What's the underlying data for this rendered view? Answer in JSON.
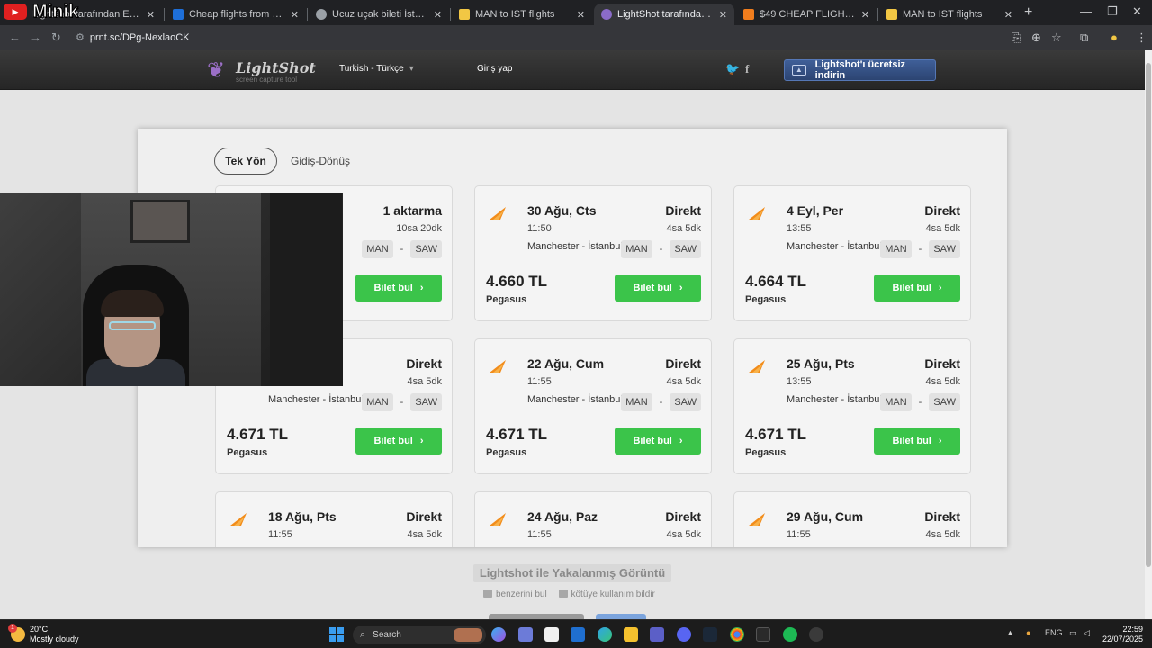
{
  "browser": {
    "tabs": [
      {
        "title": "Lightshot tarafından Ekran Görü",
        "favicon_color": "#2f7bd8"
      },
      {
        "title": "Cheap flights from Manchester",
        "favicon_color": "#1e6fd9"
      },
      {
        "title": "Ucuz uçak bileti İstanbul",
        "favicon_color": "#9aa0a6"
      },
      {
        "title": "MAN to IST flights",
        "favicon_color": "#f2c744"
      },
      {
        "title": "LightShot tarafından Ekran Görü",
        "favicon_color": "#8a6bc9"
      },
      {
        "title": "$49 CHEAP FLIGHTS from Manc",
        "favicon_color": "#f07d1d"
      },
      {
        "title": "MAN to IST flights",
        "favicon_color": "#f2c744"
      }
    ],
    "url": "prnt.sc/DPg-NexlaoCK"
  },
  "overlay": {
    "brand": "Minik"
  },
  "lightshot": {
    "logo": "LightShot",
    "tagline": "screen capture tool",
    "language": "Turkish - Türkçe",
    "login": "Giriş yap",
    "download": "Lightshot'ı ücretsiz indirin",
    "caption": "Lightshot ile Yakalanmış Görüntü",
    "link_similar": "benzerini bul",
    "link_report": "kötüye kullanım bildir"
  },
  "screenshot": {
    "trip_tabs": [
      "Tek Yön",
      "Gidiş-Dönüş"
    ],
    "button_label": "Bilet bul",
    "cards": [
      {
        "date": "",
        "time": "",
        "route": "",
        "stops": "1 aktarma",
        "duration": "10sa 20dk",
        "from": "MAN",
        "to": "SAW",
        "price": "",
        "airline": ""
      },
      {
        "date": "30 Ağu, Cts",
        "time": "11:50",
        "route": "Manchester - İstanbul",
        "stops": "Direkt",
        "duration": "4sa 5dk",
        "from": "MAN",
        "to": "SAW",
        "price": "4.660 TL",
        "airline": "Pegasus"
      },
      {
        "date": "4 Eyl, Per",
        "time": "13:55",
        "route": "Manchester - İstanbul",
        "stops": "Direkt",
        "duration": "4sa 5dk",
        "from": "MAN",
        "to": "SAW",
        "price": "4.664 TL",
        "airline": "Pegasus"
      },
      {
        "date": "",
        "time": "",
        "route": "Manchester - İstanbul",
        "stops": "Direkt",
        "duration": "4sa 5dk",
        "from": "MAN",
        "to": "SAW",
        "price": "4.671 TL",
        "airline": "Pegasus"
      },
      {
        "date": "22 Ağu, Cum",
        "time": "11:55",
        "route": "Manchester - İstanbul",
        "stops": "Direkt",
        "duration": "4sa 5dk",
        "from": "MAN",
        "to": "SAW",
        "price": "4.671 TL",
        "airline": "Pegasus"
      },
      {
        "date": "25 Ağu, Pts",
        "time": "13:55",
        "route": "Manchester - İstanbul",
        "stops": "Direkt",
        "duration": "4sa 5dk",
        "from": "MAN",
        "to": "SAW",
        "price": "4.671 TL",
        "airline": "Pegasus"
      },
      {
        "date": "18 Ağu, Pts",
        "time": "11:55",
        "route": "",
        "stops": "Direkt",
        "duration": "4sa 5dk",
        "from": "",
        "to": "",
        "price": "",
        "airline": ""
      },
      {
        "date": "24 Ağu, Paz",
        "time": "11:55",
        "route": "",
        "stops": "Direkt",
        "duration": "4sa 5dk",
        "from": "",
        "to": "",
        "price": "",
        "airline": ""
      },
      {
        "date": "29 Ağu, Cum",
        "time": "11:55",
        "route": "",
        "stops": "Direkt",
        "duration": "4sa 5dk",
        "from": "",
        "to": "",
        "price": "",
        "airline": ""
      }
    ]
  },
  "taskbar": {
    "weather_temp": "20°C",
    "weather_desc": "Mostly cloudy",
    "weather_badge": "1",
    "search": "Search",
    "lang": "ENG",
    "time": "22:59",
    "date": "22/07/2025"
  },
  "colors": {
    "accent_green": "#3bc44a",
    "pegasus_orange": "#f28c1a",
    "download_blue": "#34528a"
  }
}
